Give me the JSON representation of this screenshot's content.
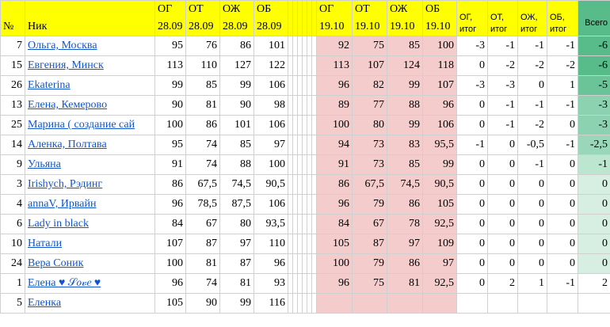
{
  "header": {
    "num": "№",
    "name": "Ник",
    "og1_a": "ОГ",
    "og1_b": "28.09",
    "ot1_a": "ОТ",
    "ot1_b": "28.09",
    "oj1_a": "ОЖ",
    "oj1_b": "28.09",
    "ob1_a": "ОБ",
    "ob1_b": "28.09",
    "og2_a": "ОГ",
    "og2_b": "19.10",
    "ot2_a": "ОТ",
    "ot2_b": "19.10",
    "oj2_a": "ОЖ",
    "oj2_b": "19.10",
    "ob2_a": "ОБ",
    "ob2_b": "19.10",
    "sog_a": "ОГ,",
    "sog_b": "итог",
    "sot_a": "ОТ,",
    "sot_b": "итог",
    "soj_a": "ОЖ,",
    "soj_b": "итог",
    "sob_a": "ОБ,",
    "sob_b": "итог",
    "total": "Всего"
  },
  "colors": {
    "header_bg": "#ffff00",
    "pink_bg": "#f4cccc",
    "link": "#1155cc"
  },
  "rows": [
    {
      "num": "7",
      "name": "Ольга, Москва",
      "og1": "95",
      "ot1": "76",
      "oj1": "86",
      "ob1": "101",
      "og2": "92",
      "ot2": "75",
      "oj2": "85",
      "ob2": "100",
      "sog": "-3",
      "sot": "-1",
      "soj": "-1",
      "sob": "-1",
      "total": "-6",
      "total_color": "#57bb8a"
    },
    {
      "num": "15",
      "name": "Евгения, Минск",
      "og1": "113",
      "ot1": "110",
      "oj1": "127",
      "ob1": "122",
      "og2": "113",
      "ot2": "107",
      "oj2": "124",
      "ob2": "118",
      "sog": "0",
      "sot": "-2",
      "soj": "-2",
      "sob": "-2",
      "total": "-6",
      "total_color": "#57bb8a"
    },
    {
      "num": "26",
      "name": "Ekaterina",
      "og1": "99",
      "ot1": "85",
      "oj1": "99",
      "ob1": "106",
      "og2": "96",
      "ot2": "82",
      "oj2": "99",
      "ob2": "107",
      "sog": "-3",
      "sot": "-3",
      "soj": "0",
      "sob": "1",
      "total": "-5",
      "total_color": "#6ac498"
    },
    {
      "num": "13",
      "name": "Елена, Кемерово",
      "og1": "90",
      "ot1": "81",
      "oj1": "90",
      "ob1": "98",
      "og2": "89",
      "ot2": "77",
      "oj2": "88",
      "ob2": "96",
      "sog": "0",
      "sot": "-1",
      "soj": "-1",
      "sob": "-1",
      "total": "-3",
      "total_color": "#8dd2b0"
    },
    {
      "num": "25",
      "name": "Марина ( создание сай",
      "og1": "100",
      "ot1": "86",
      "oj1": "101",
      "ob1": "106",
      "og2": "100",
      "ot2": "80",
      "oj2": "99",
      "ob2": "106",
      "sog": "0",
      "sot": "-1",
      "soj": "-2",
      "sob": "0",
      "total": "-3",
      "total_color": "#8dd2b0"
    },
    {
      "num": "14",
      "name": "Аленка, Полтава",
      "og1": "95",
      "ot1": "74",
      "oj1": "85",
      "ob1": "97",
      "og2": "94",
      "ot2": "73",
      "oj2": "83",
      "ob2": "95,5",
      "sog": "-1",
      "sot": "0",
      "soj": "-0,5",
      "sob": "-1",
      "total": "-2,5",
      "total_color": "#9ad7b9"
    },
    {
      "num": "9",
      "name": "Ульяна",
      "og1": "91",
      "ot1": "74",
      "oj1": "88",
      "ob1": "100",
      "og2": "91",
      "ot2": "73",
      "oj2": "85",
      "ob2": "99",
      "sog": "0",
      "sot": "0",
      "soj": "-1",
      "sob": "0",
      "total": "-1",
      "total_color": "#bde6d1"
    },
    {
      "num": "3",
      "name": "Irishych, Рэдинг",
      "og1": "86",
      "ot1": "67,5",
      "oj1": "74,5",
      "ob1": "90,5",
      "og2": "86",
      "ot2": "67,5",
      "oj2": "74,5",
      "ob2": "90,5",
      "sog": "0",
      "sot": "0",
      "soj": "0",
      "sob": "0",
      "total": "0",
      "total_color": "#d6efe2"
    },
    {
      "num": "4",
      "name": "annaV, Ирвайн",
      "og1": "96",
      "ot1": "78,5",
      "oj1": "87,5",
      "ob1": "106",
      "og2": "96",
      "ot2": "79",
      "oj2": "86",
      "ob2": "105",
      "sog": "0",
      "sot": "0",
      "soj": "0",
      "sob": "0",
      "total": "0",
      "total_color": "#d6efe2"
    },
    {
      "num": "6",
      "name": "Lady in black",
      "og1": "84",
      "ot1": "67",
      "oj1": "80",
      "ob1": "93,5",
      "og2": "84",
      "ot2": "67",
      "oj2": "78",
      "ob2": "92,5",
      "sog": "0",
      "sot": "0",
      "soj": "0",
      "sob": "0",
      "total": "0",
      "total_color": "#d6efe2"
    },
    {
      "num": "10",
      "name": "Натали",
      "og1": "107",
      "ot1": "87",
      "oj1": "97",
      "ob1": "110",
      "og2": "105",
      "ot2": "87",
      "oj2": "97",
      "ob2": "109",
      "sog": "0",
      "sot": "0",
      "soj": "0",
      "sob": "0",
      "total": "0",
      "total_color": "#d6efe2"
    },
    {
      "num": "24",
      "name": "Вера Соник",
      "og1": "100",
      "ot1": "81",
      "oj1": "87",
      "ob1": "96",
      "og2": "100",
      "ot2": "79",
      "oj2": "86",
      "ob2": "97",
      "sog": "0",
      "sot": "0",
      "soj": "0",
      "sob": "0",
      "total": "0",
      "total_color": "#d6efe2"
    },
    {
      "num": "1",
      "name": "Елена ♥ 𝒮𝑜𝓋𝑒 ♥",
      "og1": "96",
      "ot1": "74",
      "oj1": "81",
      "ob1": "93",
      "og2": "96",
      "ot2": "75",
      "oj2": "81",
      "ob2": "92,5",
      "sog": "0",
      "sot": "2",
      "soj": "1",
      "sob": "-1",
      "total": "2",
      "total_color": "#ffffff"
    },
    {
      "num": "5",
      "name": "Еленка",
      "og1": "105",
      "ot1": "90",
      "oj1": "99",
      "ob1": "116",
      "og2": "",
      "ot2": "",
      "oj2": "",
      "ob2": "",
      "sog": "",
      "sot": "",
      "soj": "",
      "sob": "",
      "total": "",
      "total_color": "#ffffff"
    }
  ]
}
